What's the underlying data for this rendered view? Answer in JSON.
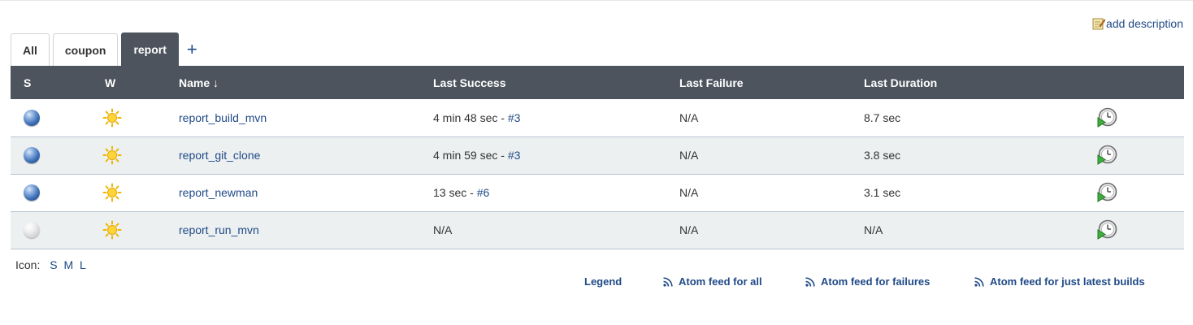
{
  "header": {
    "add_description": "add description",
    "add_description_icon": "edit-notepad-icon"
  },
  "tabs": [
    {
      "label": "All",
      "active": false
    },
    {
      "label": "coupon",
      "active": false
    },
    {
      "label": "report",
      "active": true
    }
  ],
  "new_tab_label": "+",
  "table": {
    "columns": [
      "S",
      "W",
      "Name ↓",
      "Last Success",
      "Last Failure",
      "Last Duration"
    ],
    "rows": [
      {
        "status": "blue",
        "weather": "sunny",
        "name": "report_build_mvn",
        "last_success_time": "4 min 48 sec - ",
        "last_success_build": "#3",
        "last_failure": "N/A",
        "last_duration": "8.7 sec"
      },
      {
        "status": "blue",
        "weather": "sunny",
        "name": "report_git_clone",
        "last_success_time": "4 min 59 sec - ",
        "last_success_build": "#3",
        "last_failure": "N/A",
        "last_duration": "3.8 sec"
      },
      {
        "status": "blue",
        "weather": "sunny",
        "name": "report_newman",
        "last_success_time": "13 sec - ",
        "last_success_build": "#6",
        "last_failure": "N/A",
        "last_duration": "3.1 sec"
      },
      {
        "status": "grey",
        "weather": "sunny",
        "name": "report_run_mvn",
        "last_success_time": "N/A",
        "last_success_build": "",
        "last_failure": "N/A",
        "last_duration": "N/A"
      }
    ]
  },
  "icon_sizes": {
    "label": "Icon:",
    "options": [
      "S",
      "M",
      "L"
    ]
  },
  "footer": {
    "legend": "Legend",
    "feed_all": "Atom feed for all",
    "feed_failures": "Atom feed for failures",
    "feed_latest": "Atom feed for just latest builds"
  },
  "colors": {
    "header_bg": "#4d545d",
    "link": "#204a87",
    "row_alt": "#ecf0f1",
    "status_blue": "#3d6fb8",
    "build_play_green": "#3fae3f"
  }
}
